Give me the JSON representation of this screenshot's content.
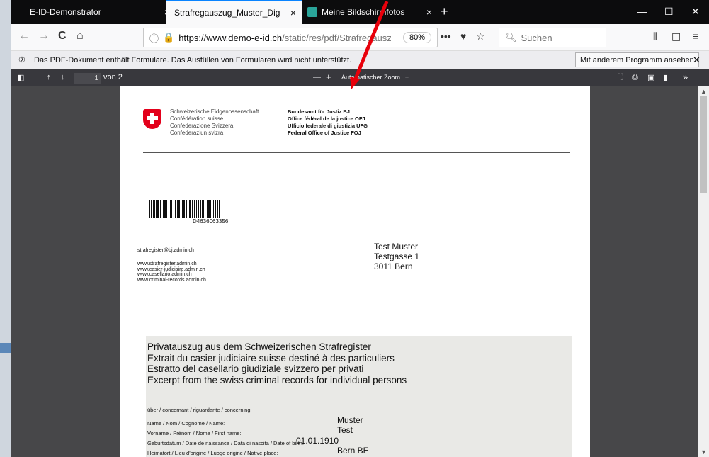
{
  "tabs": [
    {
      "title": "E-ID-Demonstrator",
      "close": "×"
    },
    {
      "title": "Strafregauszug_Muster_Digi_Null.pdf",
      "close": "×"
    },
    {
      "title": "Meine Bildschirmfotos",
      "close": "×"
    }
  ],
  "new_tab": "+",
  "window_controls": {
    "minimize": "—",
    "maximize": "☐",
    "close": "✕"
  },
  "nav": {
    "back": "←",
    "forward": "→",
    "reload": "C",
    "home": "⌂",
    "url_host": "https://www.demo-e-id.ch",
    "url_rest": "/static/res/pdf/Strafregauszu",
    "zoom": "80%",
    "page_actions": "•••",
    "search_placeholder": "Suchen"
  },
  "notification": {
    "message": "Das PDF-Dokument enthält Formulare. Das Ausfüllen von Formularen wird nicht unterstützt.",
    "button": "Mit anderem Programm ansehen",
    "close": "✕"
  },
  "pdf_toolbar": {
    "page_number": "1",
    "page_count": "von 2",
    "zoom_out": "—",
    "zoom_in": "+",
    "zoom_select": "Automatischer Zoom",
    "zoom_caret": "÷",
    "more": "»"
  },
  "document": {
    "confederation": [
      "Schweizerische Eidgenossenschaft",
      "Confédération suisse",
      "Confederazione Svizzera",
      "Confederaziun svizra"
    ],
    "office": [
      "Bundesamt für Justiz BJ",
      "Office fédéral de la justice OFJ",
      "Ufficio federale di giustizia UFG",
      "Federal Office of Justice FOJ"
    ],
    "barcode_number": "D4636063356",
    "email": "strafregister@bj.admin.ch",
    "websites": [
      "www.strafregister.admin.ch",
      "www.casier-judiciaire.admin.ch",
      "www.casellario.admin.ch",
      "www.criminal-records.admin.ch"
    ],
    "address": [
      "Test Muster",
      "Testgasse 1",
      "3011 Bern"
    ],
    "titles": [
      "Privatauszug aus dem Schweizerischen Strafregister",
      "Extrait du casier judiciaire suisse destiné à des particuliers",
      "Estratto del casellario giudiziale svizzero per privati",
      "Excerpt from the swiss criminal records for individual persons"
    ],
    "concerning": "über / concernant / riguardante / concerning",
    "fields": [
      {
        "label": "Name / Nom / Cognome / Name:",
        "value": "Muster"
      },
      {
        "label": "Vorname / Prénom / Nome / First name:",
        "value": "Test"
      },
      {
        "label": "Geburtsdatum / Date de naissance / Data di nascita / Date of birth:",
        "value": "01.01.1910"
      },
      {
        "label": "Heimatort / Lieu d'origine / Luogo origine / Native place:",
        "value": "Bern BE"
      }
    ]
  },
  "colors": {
    "annotation_arrow": "#e8000b",
    "swiss_red": "#e3001b"
  }
}
